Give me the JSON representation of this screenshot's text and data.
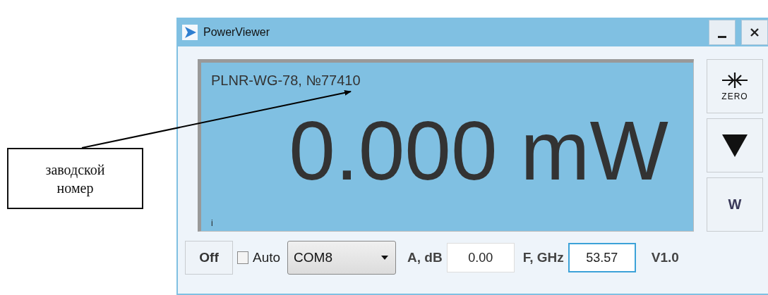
{
  "callout": {
    "text": "заводской номер"
  },
  "window": {
    "title": "PowerViewer"
  },
  "display": {
    "serial": "PLNR-WG-78, №77410",
    "reading": "0.000 mW",
    "indicator": "i"
  },
  "side_buttons": [
    {
      "kind": "zero",
      "label": "ZERO"
    },
    {
      "kind": "down"
    },
    {
      "kind": "unit",
      "label": "W"
    }
  ],
  "bottom_bar": {
    "power_button": "Off",
    "auto": {
      "label": "Auto",
      "checked": false
    },
    "port": {
      "value": "COM8"
    },
    "fields": [
      {
        "label": "A, dB",
        "value": "0.00",
        "focused": false
      },
      {
        "label": "F, GHz",
        "value": "53.57",
        "focused": true
      }
    ],
    "version": "V1.0"
  }
}
